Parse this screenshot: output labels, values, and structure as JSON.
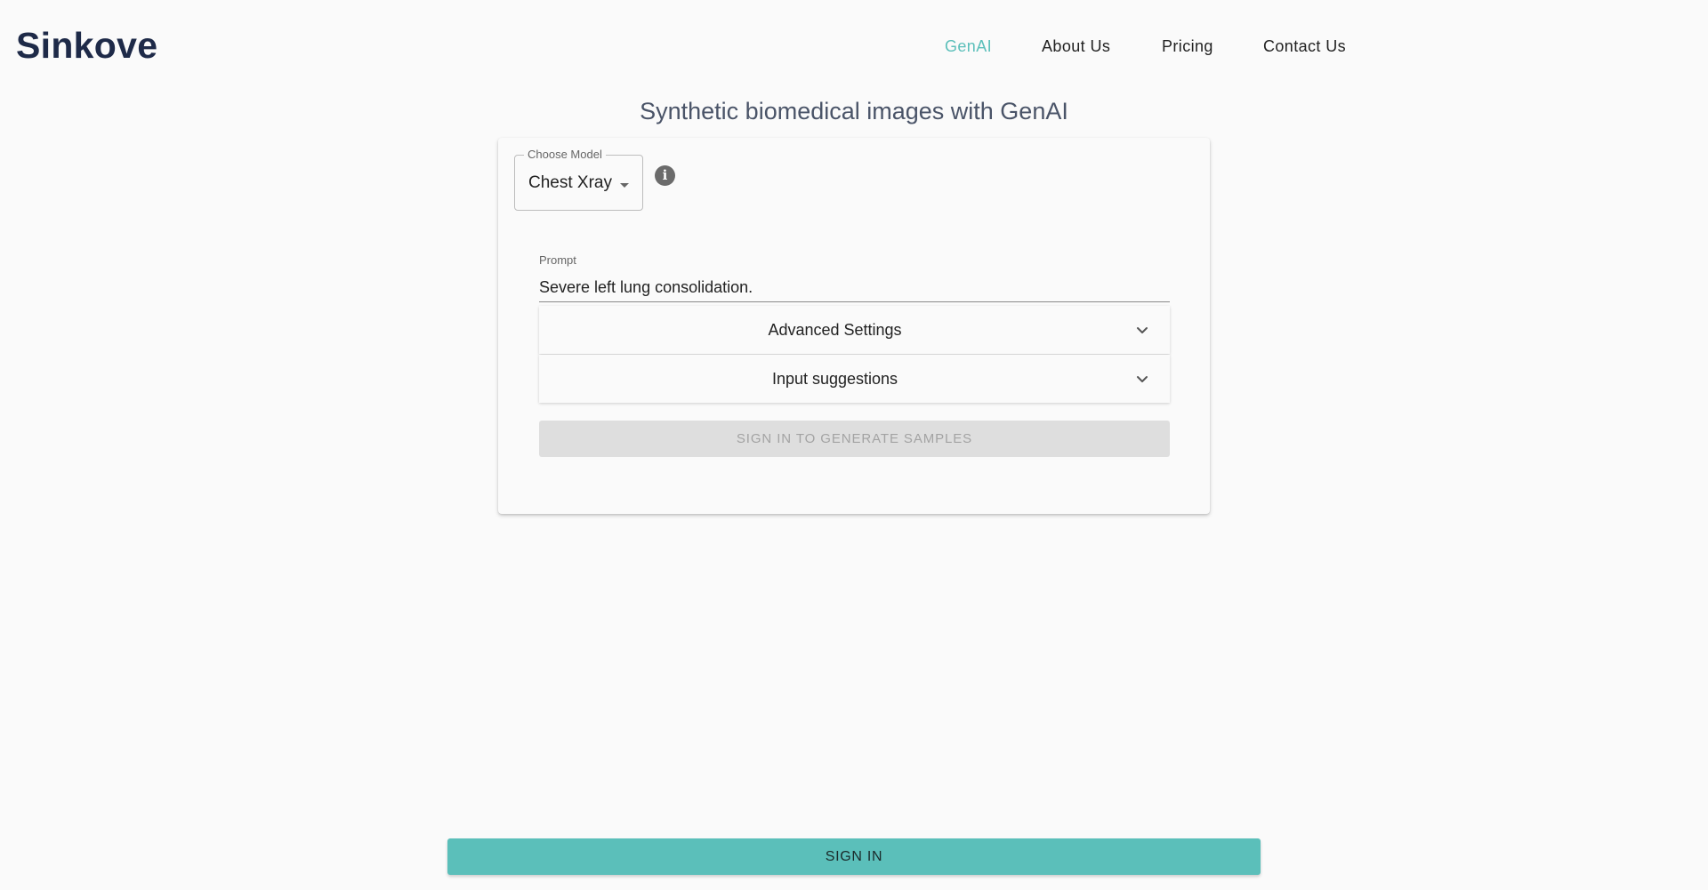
{
  "brand": {
    "name": "Sinkove"
  },
  "nav": {
    "items": [
      {
        "label": "GenAI",
        "active": true
      },
      {
        "label": "About Us",
        "active": false
      },
      {
        "label": "Pricing",
        "active": false
      },
      {
        "label": "Contact Us",
        "active": false
      }
    ]
  },
  "main": {
    "title": "Synthetic biomedical images with GenAI",
    "model_select": {
      "label": "Choose Model",
      "value": "Chest Xray",
      "icon": "caret-down-icon"
    },
    "info": {
      "icon": "info-icon",
      "glyph": "i"
    },
    "prompt": {
      "label": "Prompt",
      "value": "Severe left lung consolidation."
    },
    "accordions": [
      {
        "label": "Advanced Settings",
        "icon": "chevron-down-icon"
      },
      {
        "label": "Input suggestions",
        "icon": "chevron-down-icon"
      }
    ],
    "generate_button": {
      "label": "SIGN IN TO GENERATE SAMPLES",
      "disabled": true
    }
  },
  "footer": {
    "signin_button": {
      "label": "SIGN IN"
    }
  },
  "colors": {
    "accent": "#5bbfba",
    "brand_text": "#1e2a48",
    "background": "#fafafa",
    "disabled_bg": "#dedede",
    "disabled_text": "#a3a3a3"
  }
}
